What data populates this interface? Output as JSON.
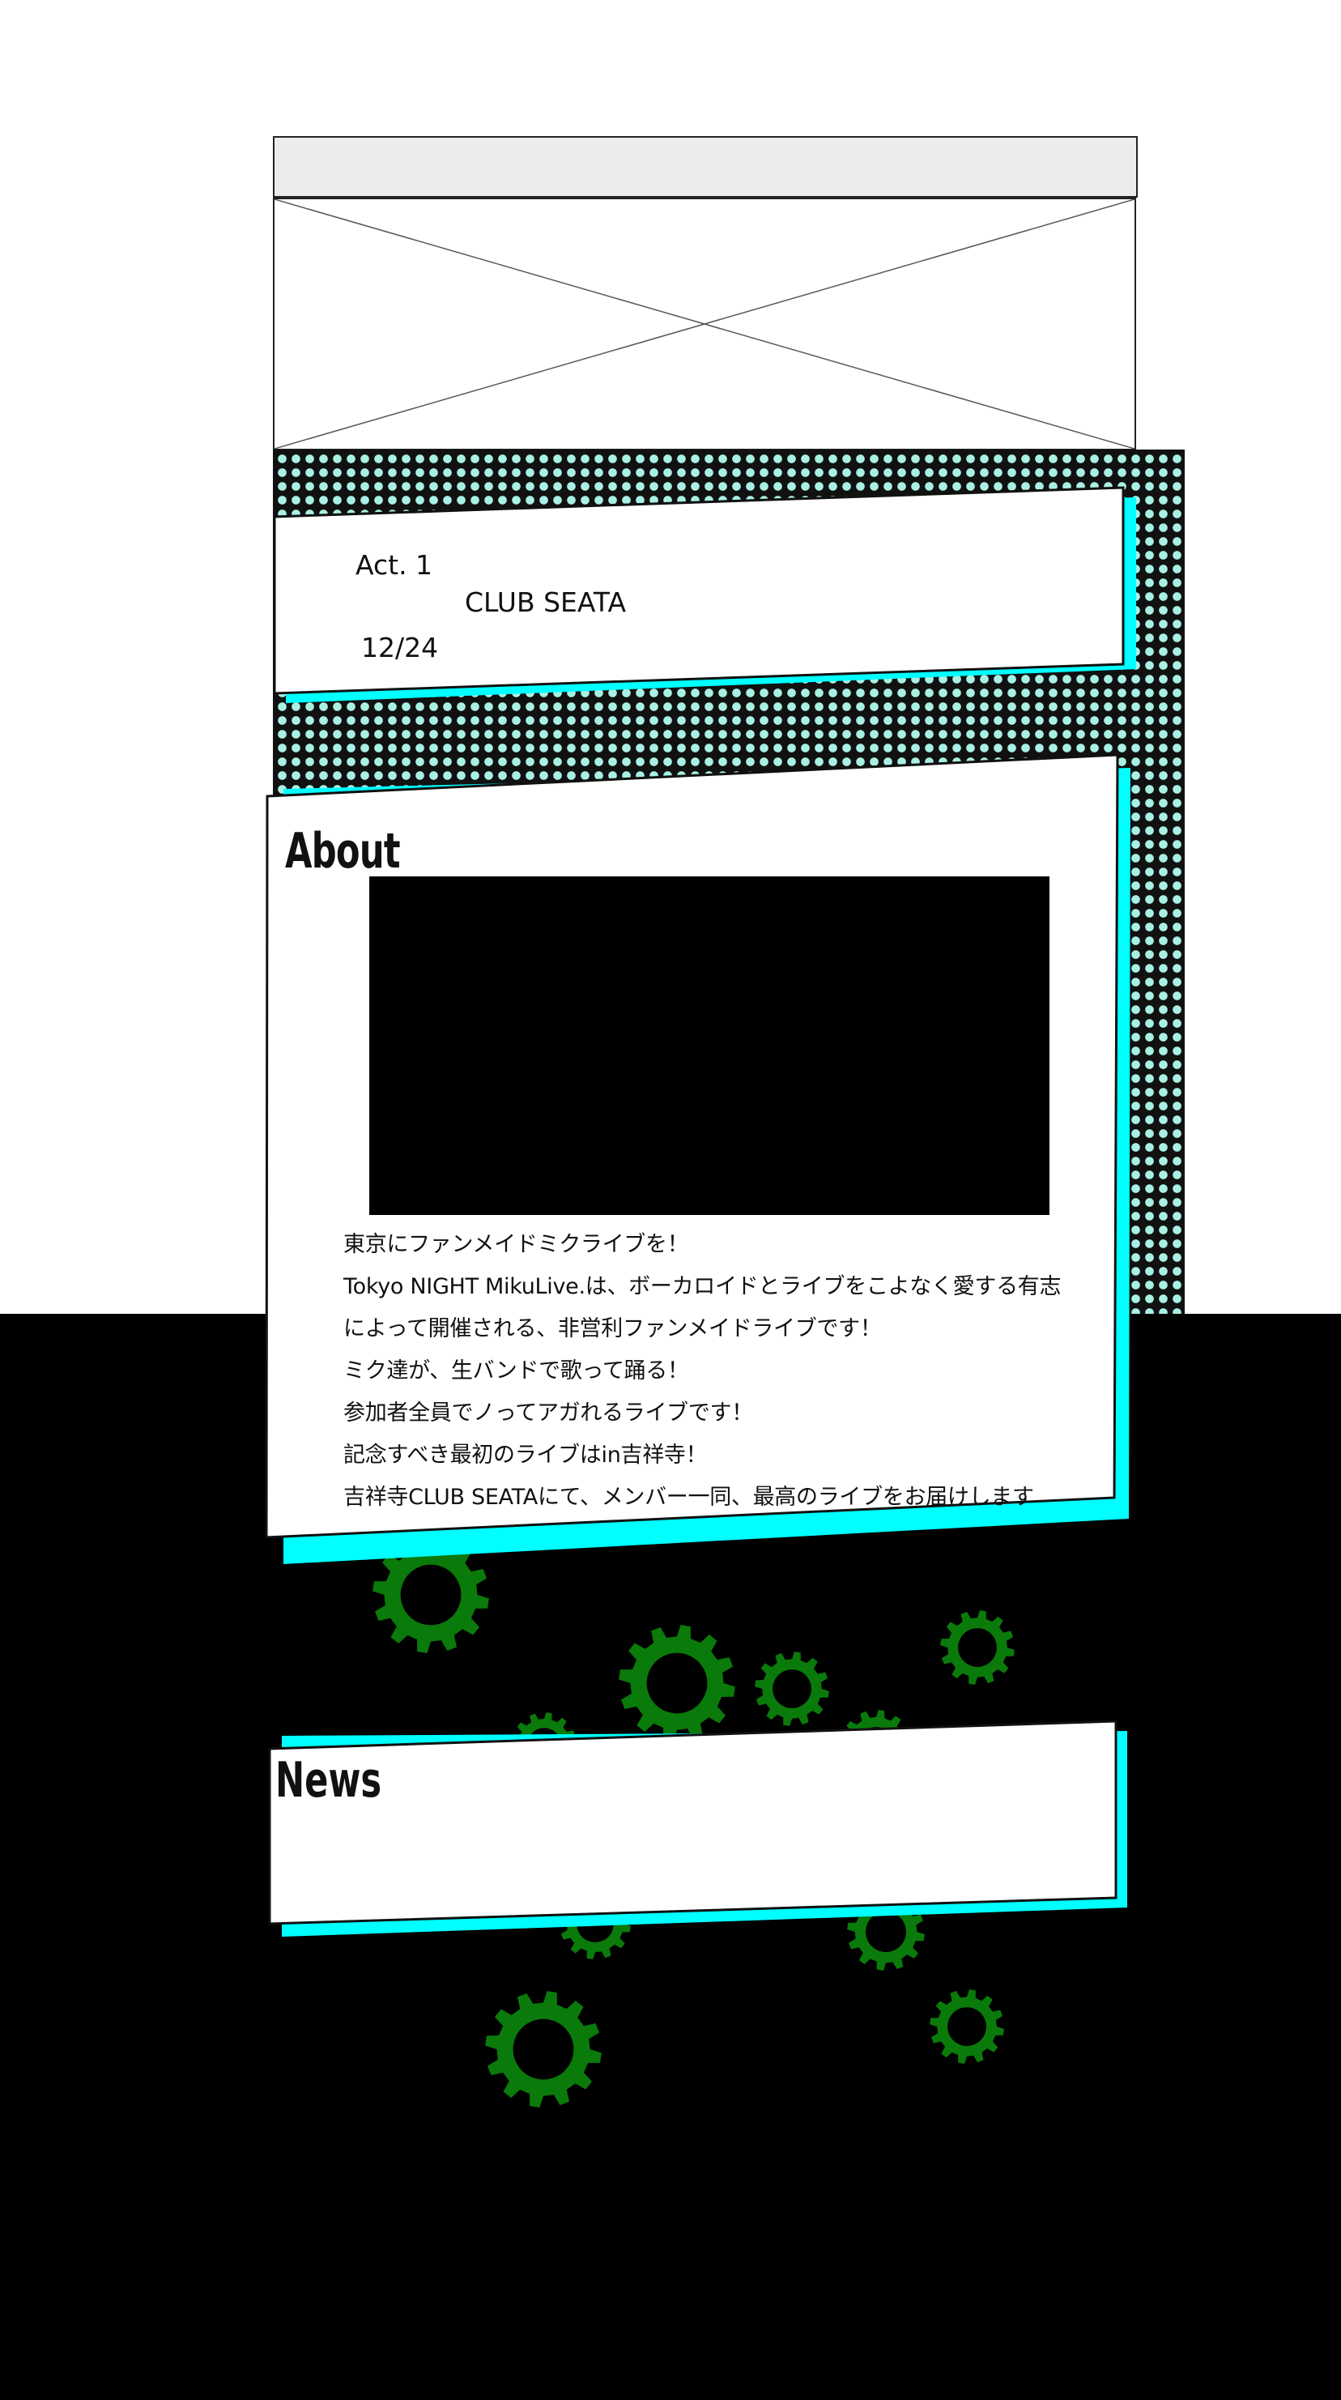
{
  "colors": {
    "accent_cyan": "#00ffff",
    "dot_color": "#a9f0e4",
    "gear_green": "#0a7a0a",
    "background_dark": "#000000"
  },
  "act": {
    "label": "Act. 1",
    "venue": "CLUB  SEATA",
    "date": "12/24"
  },
  "about": {
    "title": "About",
    "lines": [
      "東京にファンメイドミクライブを！",
      "Tokyo NIGHT MikuLive.は、ボーカロイドとライブをこよなく愛する有志",
      "によって開催される、非営利ファンメイドライブです！",
      "ミク達が、生バンドで歌って踊る！",
      "参加者全員でノってアガれるライブです！",
      "記念すべき最初のライブはin吉祥寺！",
      "吉祥寺CLUB SEATAにて、メンバー一同、最高のライブをお届けします"
    ]
  },
  "news": {
    "title": "News"
  },
  "decor": {
    "icons": [
      "gear-icon"
    ]
  }
}
